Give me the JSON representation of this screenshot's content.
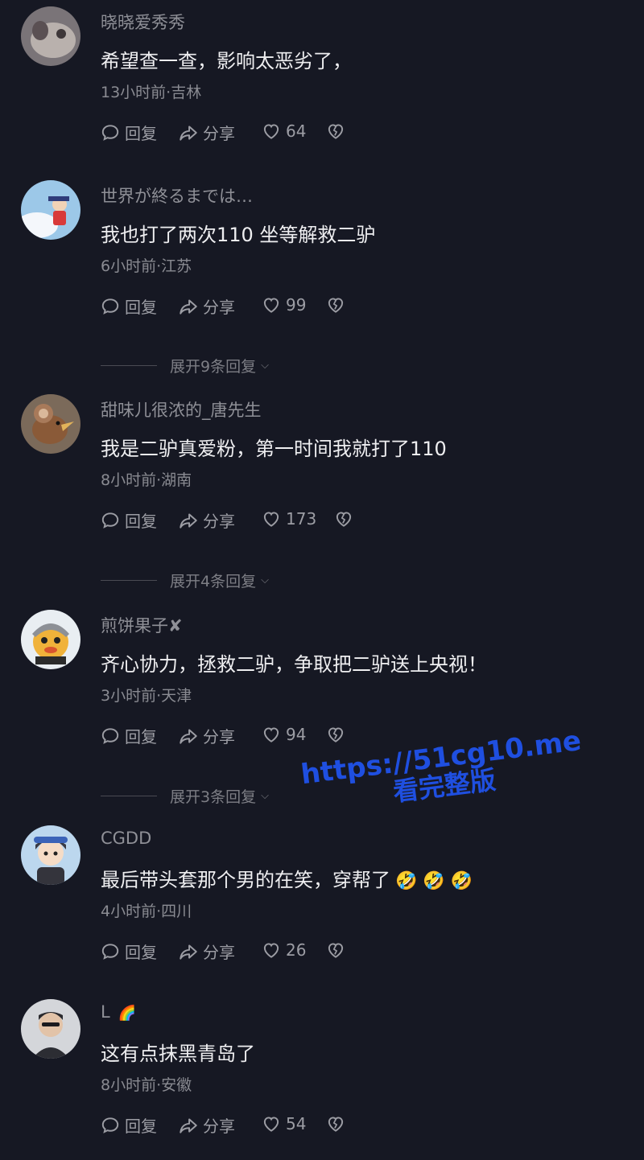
{
  "comments": [
    {
      "user": "晓晓爱秀秀",
      "user_extra": "",
      "text": "希望查一查，影响太恶劣了，",
      "emoji": "",
      "meta": "13小时前·吉林",
      "reply": "回复",
      "share": "分享",
      "likes": "64",
      "expand": ""
    },
    {
      "user": "世界が終るまでは…",
      "user_extra": "",
      "text": "我也打了两次110 坐等解救二驴",
      "emoji": "",
      "meta": "6小时前·江苏",
      "reply": "回复",
      "share": "分享",
      "likes": "99",
      "expand": "展开9条回复"
    },
    {
      "user": "甜味儿很浓的_唐先生",
      "user_extra": "",
      "text": "我是二驴真爱粉，第一时间我就打了110",
      "emoji": "",
      "meta": "8小时前·湖南",
      "reply": "回复",
      "share": "分享",
      "likes": "173",
      "expand": "展开4条回复"
    },
    {
      "user": "煎饼果子✘",
      "user_extra": "",
      "text": "齐心协力，拯救二驴，争取把二驴送上央视！",
      "emoji": "",
      "meta": "3小时前·天津",
      "reply": "回复",
      "share": "分享",
      "likes": "94",
      "expand": "展开3条回复"
    },
    {
      "user": "CGDD",
      "user_extra": "",
      "text": "最后带头套那个男的在笑，穿帮了",
      "emoji": "🤣 🤣 🤣",
      "meta": "4小时前·四川",
      "reply": "回复",
      "share": "分享",
      "likes": "26",
      "expand": ""
    },
    {
      "user": "L",
      "user_extra": "🌈",
      "text": "这有点抹黑青岛了",
      "emoji": "",
      "meta": "8小时前·安徽",
      "reply": "回复",
      "share": "分享",
      "likes": "54",
      "expand": ""
    }
  ],
  "watermark": {
    "url": "https://51cg10.me",
    "sub": "看完整版"
  },
  "colors": {
    "background": "#161823",
    "watermark": "#1f4fe0"
  }
}
